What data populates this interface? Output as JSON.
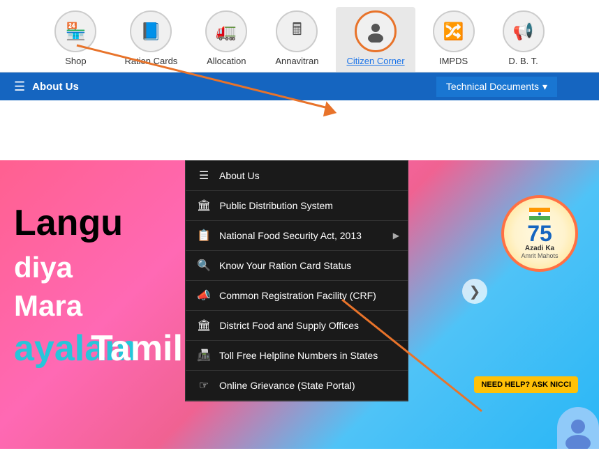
{
  "nav": {
    "items": [
      {
        "id": "shop",
        "label": "Shop",
        "icon": "🏪",
        "highlighted": false
      },
      {
        "id": "ration-cards",
        "label": "Ration Cards",
        "icon": "📘",
        "highlighted": false
      },
      {
        "id": "allocation",
        "label": "Allocation",
        "icon": "🚛",
        "highlighted": false
      },
      {
        "id": "annavitran",
        "label": "Annavitran",
        "icon": "🖩",
        "highlighted": false
      },
      {
        "id": "citizen-corner",
        "label": "Citizen Corner",
        "icon": "👤",
        "highlighted": true
      },
      {
        "id": "impds",
        "label": "IMPDS",
        "icon": "🔀",
        "highlighted": false
      },
      {
        "id": "dbt",
        "label": "D. B. T.",
        "icon": "📢",
        "highlighted": false
      }
    ]
  },
  "blue_bar": {
    "menu_label": "About Us",
    "tech_docs_label": "Technical Documents",
    "chevron": "▾"
  },
  "dropdown": {
    "items": [
      {
        "id": "about-us",
        "label": "About Us",
        "icon": "≡",
        "has_arrow": false
      },
      {
        "id": "public-distribution",
        "label": "Public Distribution System",
        "icon": "🏛",
        "has_arrow": false
      },
      {
        "id": "national-food-security",
        "label": "National Food Security Act, 2013",
        "icon": "📋",
        "has_arrow": true
      },
      {
        "id": "know-ration-card",
        "label": "Know Your Ration Card Status",
        "icon": "🔍",
        "has_arrow": false
      },
      {
        "id": "common-registration",
        "label": "Common Registration Facility (CRF)",
        "icon": "📣",
        "has_arrow": false
      },
      {
        "id": "district-food",
        "label": "District Food and Supply Offices",
        "icon": "🏛",
        "has_arrow": false
      },
      {
        "id": "toll-free",
        "label": "Toll Free Helpline Numbers in States",
        "icon": "📠",
        "has_arrow": false
      },
      {
        "id": "online-grievance",
        "label": "Online Grievance (State Portal)",
        "icon": "☞",
        "has_arrow": false
      }
    ]
  },
  "banner": {
    "text1": "Langu",
    "text2": "diya",
    "text3": "Mara",
    "text4": "ayalam",
    "text5": "Tamil",
    "azadi_number": "75",
    "azadi_line1": "Azadi Ka",
    "azadi_line2": "Amrit Mahots",
    "chevron_right": "❯"
  },
  "nicci": {
    "label": "NEED HELP? ASK NICCI"
  },
  "colors": {
    "orange_arrow": "#e8732a",
    "blue_bar": "#1565c0",
    "dropdown_bg": "#1a1a1a",
    "nicci_bg": "#ffc107"
  }
}
